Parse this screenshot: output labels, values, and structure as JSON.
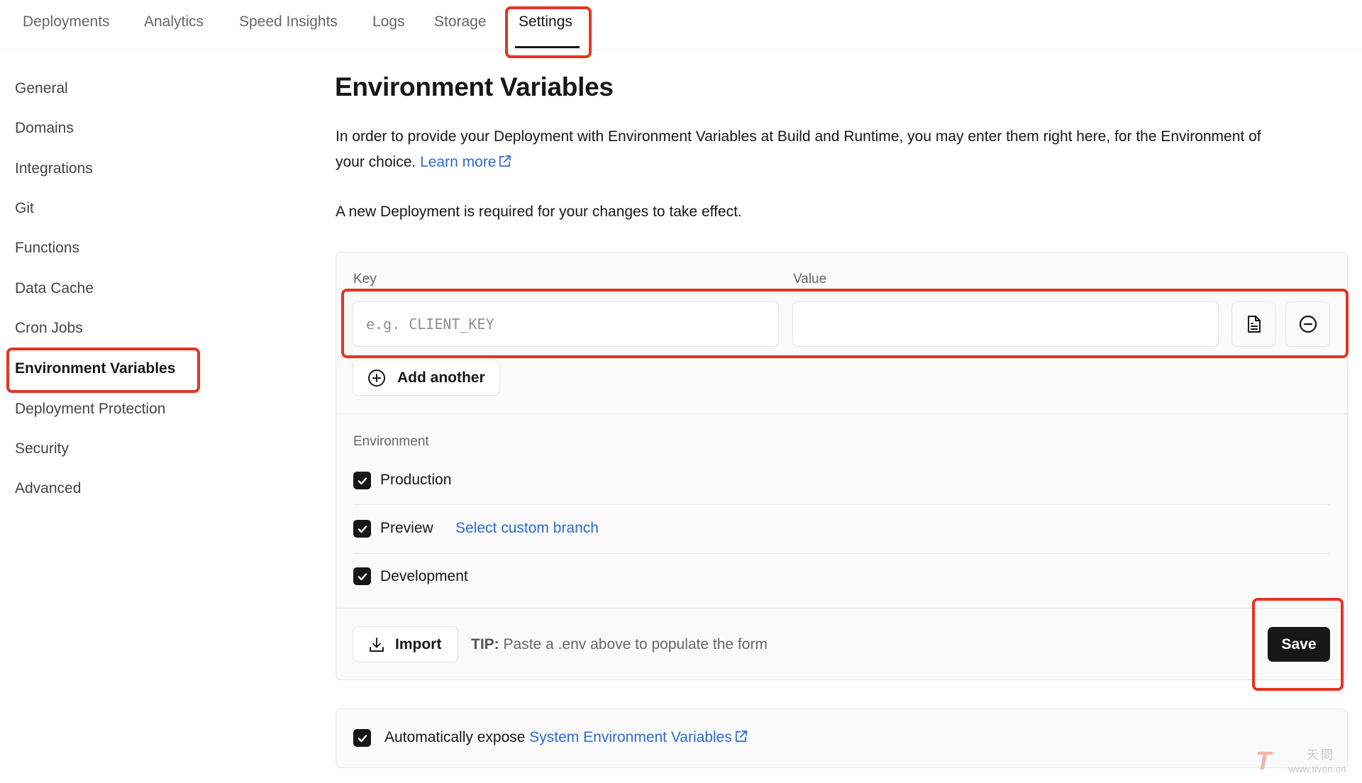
{
  "topnav": {
    "tabs": [
      {
        "label": "Deployments"
      },
      {
        "label": "Analytics"
      },
      {
        "label": "Speed Insights"
      },
      {
        "label": "Logs"
      },
      {
        "label": "Storage"
      },
      {
        "label": "Settings",
        "active": true
      }
    ]
  },
  "sidebar": {
    "items": [
      {
        "label": "General"
      },
      {
        "label": "Domains"
      },
      {
        "label": "Integrations"
      },
      {
        "label": "Git"
      },
      {
        "label": "Functions"
      },
      {
        "label": "Data Cache"
      },
      {
        "label": "Cron Jobs"
      },
      {
        "label": "Environment Variables",
        "active": true
      },
      {
        "label": "Deployment Protection"
      },
      {
        "label": "Security"
      },
      {
        "label": "Advanced"
      }
    ]
  },
  "main": {
    "title": "Environment Variables",
    "description_line1": "In order to provide your Deployment with Environment Variables at Build and Runtime, you may enter them right here, for the Environment of",
    "description_line2": "your choice.",
    "learn_more": "Learn more",
    "notice": "A new Deployment is required for your changes to take effect.",
    "form": {
      "key_label": "Key",
      "key_placeholder": "e.g. CLIENT_KEY",
      "key_value": "",
      "value_label": "Value",
      "value_value": "",
      "note_icon": "file-text-icon",
      "remove_icon": "minus-circle-icon",
      "add_another_label": "Add another",
      "environment_label": "Environment",
      "environments": [
        {
          "label": "Production",
          "checked": true
        },
        {
          "label": "Preview",
          "checked": true,
          "link": "Select custom branch"
        },
        {
          "label": "Development",
          "checked": true
        }
      ],
      "import_label": "Import",
      "tip_prefix": "TIP:",
      "tip_text": "Paste a .env above to populate the form",
      "save_label": "Save"
    },
    "system_env": {
      "checked": true,
      "label": "Automatically expose",
      "link": "System Environment Variables"
    }
  },
  "colors": {
    "accent_link": "#2b6bd1",
    "highlight": "#e5341f",
    "primary_button": "#171717"
  },
  "watermark": {
    "logo": "T",
    "chinese": "天問",
    "url": "www.tiven.cn"
  }
}
